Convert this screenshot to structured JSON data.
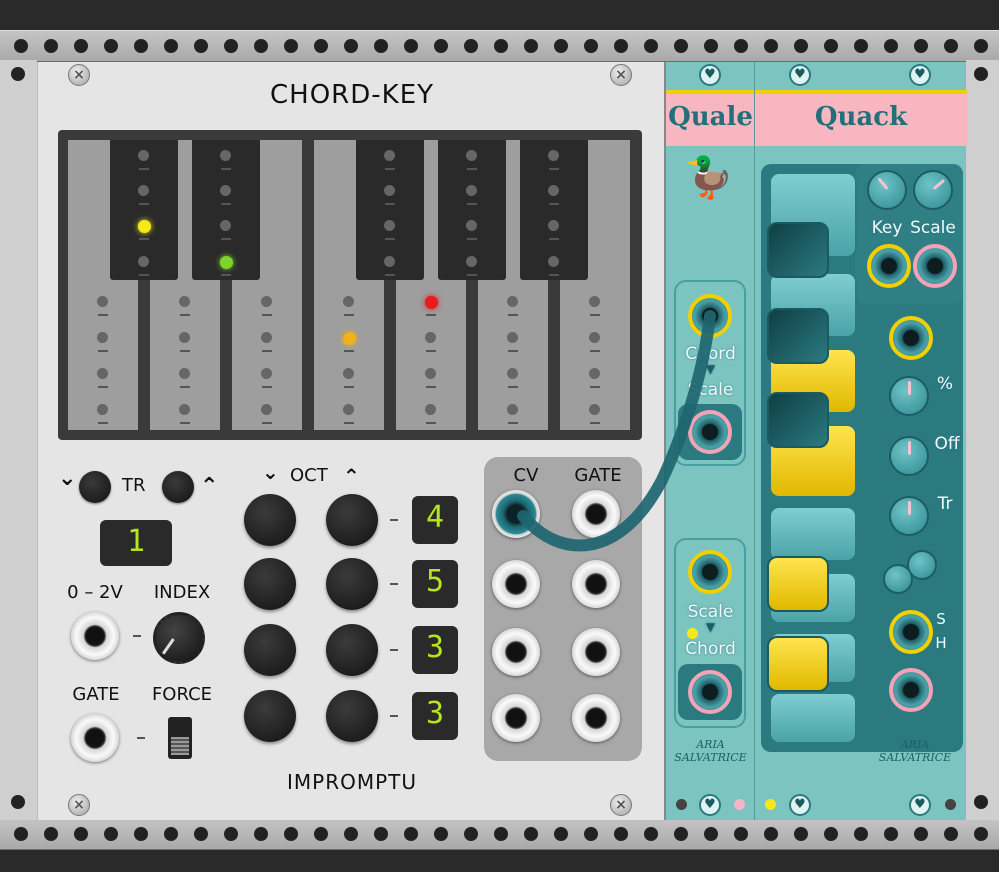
{
  "rack": {
    "rail_color": "#b8b8b8"
  },
  "chord_key": {
    "title": "CHORD-KEY",
    "brand": "IMPROMPTU",
    "tr_label": "TR",
    "tr_down": "⌄",
    "tr_up": "⌃",
    "tr_display": "1",
    "oct_label": "OCT",
    "oct_down": "⌄",
    "oct_up": "⌃",
    "oct_displays": [
      "4",
      "5",
      "3",
      "3"
    ],
    "range_label": "0 – 2V",
    "index_label": "INDEX",
    "gate_label": "GATE",
    "force_label": "FORCE",
    "out_cv_label": "CV",
    "out_gate_label": "GATE",
    "key_leds": {
      "yellow": "#f7e81c",
      "green": "#7fd42a",
      "orange": "#f2b01c",
      "red": "#e81c1c"
    }
  },
  "quale": {
    "title": "Quale",
    "label_chord_top": "Chord",
    "label_scale_top": "Scale",
    "label_scale_bottom": "Scale",
    "label_chord_bottom": "Chord",
    "signature": "ARIA SALVATRICE",
    "arrow": "▼"
  },
  "quack": {
    "title": "Quack",
    "key_label": "Key",
    "scale_label": "Scale",
    "percent_label": "%",
    "off_label": "Off",
    "tr_label": "Tr",
    "s_label": "S",
    "h_label": "H",
    "signature": "ARIA SALVATRICE"
  },
  "colors": {
    "accent_teal": "#7cc4c0",
    "pink": "#f7b6c0",
    "yellow": "#f2d000",
    "cable": "#1e6670"
  }
}
